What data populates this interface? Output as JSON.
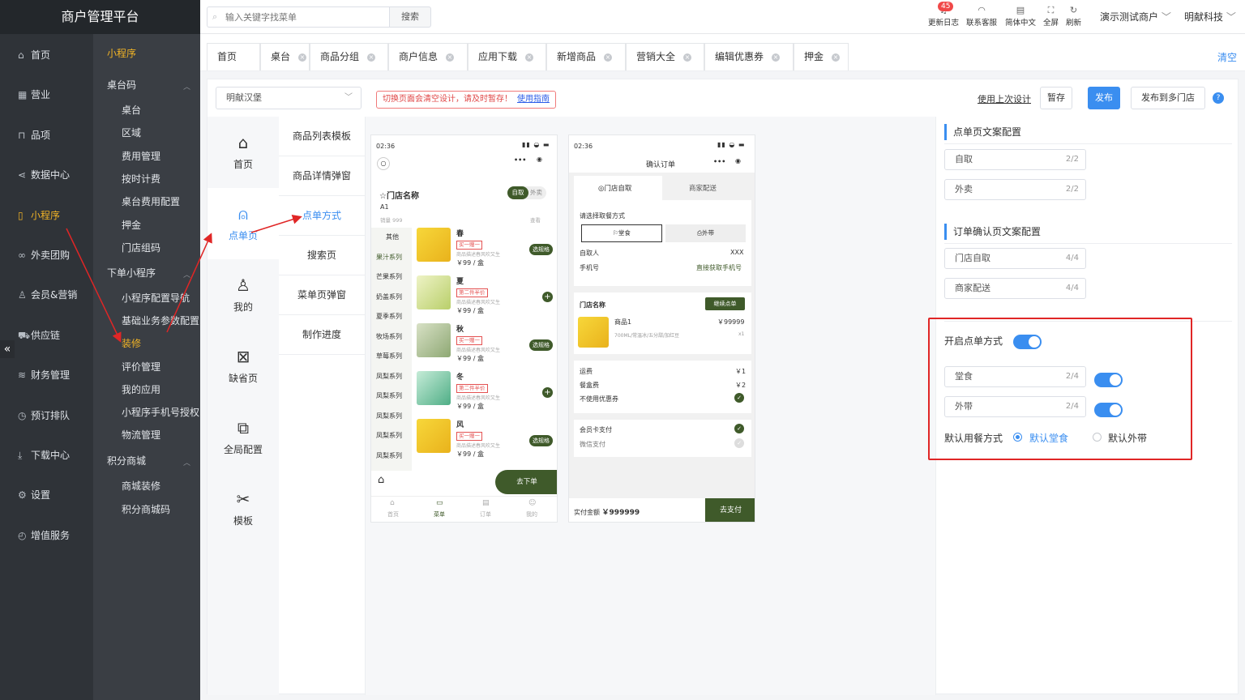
{
  "brand": "商户管理平台",
  "nav_main": [
    {
      "label": "首页",
      "icon": "home-icon"
    },
    {
      "label": "营业",
      "icon": "calendar-icon"
    },
    {
      "label": "品项",
      "icon": "bag-icon"
    },
    {
      "label": "数据中心",
      "icon": "share-icon"
    },
    {
      "label": "小程序",
      "icon": "tablet-icon"
    },
    {
      "label": "外卖团购",
      "icon": "bike-icon"
    },
    {
      "label": "会员&营销",
      "icon": "user-icon"
    },
    {
      "label": "供应链",
      "icon": "truck-icon"
    },
    {
      "label": "财务管理",
      "icon": "database-icon"
    },
    {
      "label": "预订排队",
      "icon": "clock-icon"
    },
    {
      "label": "下载中心",
      "icon": "download-icon"
    },
    {
      "label": "设置",
      "icon": "gear-icon"
    },
    {
      "label": "增值服务",
      "icon": "timer-icon"
    }
  ],
  "nav_sub": {
    "title": "小程序",
    "group1": "桌台码",
    "g1_items": [
      "桌台",
      "区域",
      "费用管理",
      "按时计费",
      "桌台费用配置",
      "押金",
      "门店组码"
    ],
    "group2": "下单小程序",
    "g2_items": [
      "小程序配置导航",
      "基础业务参数配置",
      "装修",
      "评价管理",
      "我的应用",
      "小程序手机号授权",
      "物流管理"
    ],
    "group3": "积分商城",
    "g3_items": [
      "商城装修",
      "积分商城码"
    ]
  },
  "topbar": {
    "search_placeholder": "输入关键字找菜单",
    "search_btn": "搜索",
    "tools": [
      {
        "label": "更新日志",
        "badge": "45"
      },
      {
        "label": "联系客服"
      },
      {
        "label": "简体中文"
      },
      {
        "label": "全屏"
      },
      {
        "label": "刷新"
      }
    ],
    "merchant": "演示测试商户",
    "company": "明献科技"
  },
  "tabs": [
    "首页",
    "桌台",
    "商品分组",
    "商户信息",
    "应用下载",
    "新增商品",
    "营销大全",
    "编辑优惠券",
    "押金"
  ],
  "clear_all": "清空",
  "toolbar": {
    "store": "明献汉堡",
    "warning": "切换页面会清空设计，请及时暂存！",
    "guide": "使用指南",
    "use_last": "使用上次设计",
    "save": "暂存",
    "publish": "发布",
    "publish_multi": "发布到多门店"
  },
  "pages": [
    "首页",
    "点单页",
    "我的",
    "缺省页",
    "全局配置",
    "模板"
  ],
  "subpages": [
    "商品列表模板",
    "商品详情弹窗",
    "点单方式",
    "搜索页",
    "菜单页弹窗",
    "制作进度"
  ],
  "phone1": {
    "time": "02:36",
    "store_name": "☆门店名称",
    "table": "A1",
    "sales": "销量 999",
    "pickup": "自取",
    "delivery": "外卖",
    "more": "查看",
    "categories": [
      "其他",
      "果汁系列",
      "芒果系列",
      "奶盖系列",
      "夏季系列",
      "牧场系列",
      "草莓系列",
      "凤梨系列",
      "凤梨系列",
      "凤梨系列",
      "凤梨系列",
      "凤梨系列"
    ],
    "products": [
      {
        "name": "春",
        "tag": "买一赠一",
        "desc": "商品描述春风吹又生",
        "price": "￥99 / 盒",
        "action": "选规格"
      },
      {
        "name": "夏",
        "tag": "第二件半价",
        "desc": "商品描述春风吹又生",
        "price": "￥99 / 盒",
        "action": "+"
      },
      {
        "name": "秋",
        "tag": "买一赠一",
        "desc": "商品描述春风吹又生",
        "price": "￥99 / 盒",
        "action": "选规格"
      },
      {
        "name": "冬",
        "tag": "第二件半价",
        "desc": "商品描述春风吹又生",
        "price": "￥99 / 盒",
        "action": "+"
      },
      {
        "name": "风",
        "tag": "买一赠一",
        "desc": "商品描述春风吹又生",
        "price": "￥99 / 盒",
        "action": "选规格"
      }
    ],
    "order_btn": "去下单",
    "tabbar": [
      "首页",
      "菜单",
      "订单",
      "我的"
    ]
  },
  "phone2": {
    "time": "02:36",
    "title": "确认订单",
    "tab_pickup": "门店自取",
    "tab_delivery": "商家配送",
    "choose_label": "请选择取餐方式",
    "dine_in": "堂食",
    "takeaway": "外带",
    "picker_label": "自取人",
    "picker_value": "XXX",
    "phone_label": "手机号",
    "phone_value": "直接获取手机号",
    "store_name": "门店名称",
    "continue": "继续点单",
    "product": "商品1",
    "product_price": "￥99999",
    "product_spec": "700ML/常温冰/五分甜/加红豆",
    "product_qty": "x1",
    "fee1_label": "运费",
    "fee1": "￥1",
    "fee2_label": "餐盒费",
    "fee2": "￥2",
    "coupon": "不使用优惠券",
    "pay1": "会员卡支付",
    "pay2": "微信支付",
    "total_label": "实付金额",
    "total": "￥999999",
    "pay_btn": "去支付"
  },
  "props": {
    "sect1": "点单页文案配置",
    "f1": "自取",
    "f1c": "2/2",
    "f2": "外卖",
    "f2c": "2/2",
    "sect2": "订单确认页文案配置",
    "f3": "门店自取",
    "f3c": "4/4",
    "f4": "商家配送",
    "f4c": "4/4",
    "enable_label": "开启点单方式",
    "f5": "堂食",
    "f5c": "2/4",
    "f6": "外带",
    "f6c": "2/4",
    "default_label": "默认用餐方式",
    "opt1": "默认堂食",
    "opt2": "默认外带"
  }
}
